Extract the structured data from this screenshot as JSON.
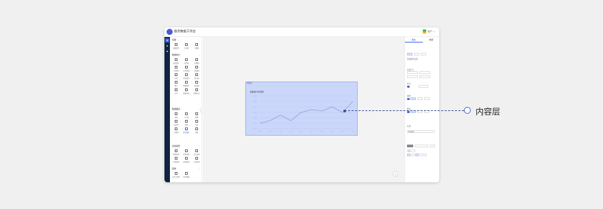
{
  "titlebar": {
    "app_title": "服务数据工作台",
    "user_name": "用户"
  },
  "rail": {
    "items": [
      {
        "name": "rail-item-components",
        "active": true
      },
      {
        "name": "rail-item-layers",
        "active": false
      },
      {
        "name": "rail-item-data",
        "active": false
      }
    ]
  },
  "left_panel": {
    "sections": [
      {
        "title": "基础",
        "items": [
          "基础组件",
          "文本框",
          "日期框"
        ]
      },
      {
        "title": "数据统计",
        "items": [
          "表格组件",
          "柱状图",
          "折线图",
          "饼状图",
          "文本框组",
          "面积图",
          "标签",
          "指标组件",
          "漏斗图",
          "散点",
          "地图组件",
          "雷达图",
          "文本",
          "数据列表",
          "地图标注"
        ]
      },
      {
        "title": "数据图表",
        "items": [
          "表格",
          "卡片组",
          "轮播",
          "进度条",
          "树形",
          "日历",
          "分割线",
          "标签组件",
          "按钮"
        ]
      },
      {
        "title": "表格组件",
        "items": [
          "基础表格",
          "树形表格",
          "交叉表格",
          "分组表格",
          "多级表格",
          "分页表格"
        ]
      },
      {
        "title": "其他",
        "items": [
          "自定义组件",
          "组件模板"
        ]
      }
    ]
  },
  "canvas": {
    "layer_tag": "内容层",
    "chart_title": "数据统计折线图"
  },
  "chart_data": {
    "type": "line",
    "title": "数据统计折线图",
    "series": [
      {
        "values": [
          2,
          3,
          5,
          3,
          6,
          7,
          6.5,
          8,
          6,
          10
        ]
      }
    ],
    "ylim": [
      0,
      12
    ],
    "grid": true
  },
  "right_panel": {
    "tabs": [
      "属性",
      "数据"
    ],
    "labels": [
      "基础属性设置",
      "位置尺寸",
      "样式",
      "图例",
      "数值",
      "标题"
    ],
    "font_name": "Regular",
    "font_size": "12"
  },
  "callout": {
    "label": "内容层"
  },
  "colors": {
    "accent": "#3d63e0",
    "rail": "#0f2440",
    "layer_fill": "#becdfc"
  }
}
